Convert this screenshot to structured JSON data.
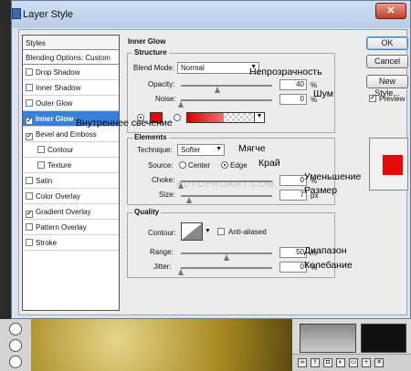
{
  "window": {
    "title": "Layer Style",
    "close": "✕"
  },
  "styles_panel": {
    "header": "Styles",
    "blending": "Blending Options: Custom",
    "items": [
      {
        "label": "Drop Shadow",
        "checked": false
      },
      {
        "label": "Inner Shadow",
        "checked": false
      },
      {
        "label": "Outer Glow",
        "checked": false
      },
      {
        "label": "Inner Glow",
        "checked": true,
        "selected": true
      },
      {
        "label": "Bevel and Emboss",
        "checked": true
      },
      {
        "label": "Contour",
        "checked": false,
        "indent": true
      },
      {
        "label": "Texture",
        "checked": false,
        "indent": true
      },
      {
        "label": "Satin",
        "checked": false
      },
      {
        "label": "Color Overlay",
        "checked": false
      },
      {
        "label": "Gradient Overlay",
        "checked": true
      },
      {
        "label": "Pattern Overlay",
        "checked": false
      },
      {
        "label": "Stroke",
        "checked": false
      }
    ]
  },
  "inner_glow": {
    "title": "Inner Glow",
    "structure": {
      "title": "Structure",
      "blend_mode_label": "Blend Mode:",
      "blend_mode_value": "Normal",
      "opacity_label": "Opacity:",
      "opacity_value": "40",
      "opacity_unit": "%",
      "opacity_fraction": 0.4,
      "noise_label": "Noise:",
      "noise_value": "0",
      "noise_unit": "%",
      "noise_fraction": 0,
      "color": "#e10d0d"
    },
    "elements": {
      "title": "Elements",
      "technique_label": "Technique:",
      "technique_value": "Softer",
      "source_label": "Source:",
      "source_center": "Center",
      "source_edge": "Edge",
      "source_selected": "Edge",
      "choke_label": "Choke:",
      "choke_value": "0",
      "choke_unit": "%",
      "choke_fraction": 0,
      "size_label": "Size:",
      "size_value": "7",
      "size_unit": "px"
    },
    "quality": {
      "title": "Quality",
      "contour_label": "Contour:",
      "anti_aliased_label": "Anti-aliased",
      "anti_aliased": false,
      "range_label": "Range:",
      "range_value": "50",
      "range_unit": "%",
      "range_fraction": 0.5,
      "jitter_label": "Jitter:",
      "jitter_value": "0",
      "jitter_unit": "%",
      "jitter_fraction": 0
    }
  },
  "buttons": {
    "ok": "OK",
    "cancel": "Cancel",
    "new_style": "New Style...",
    "preview_label": "Preview",
    "preview_checked": true,
    "preview_color": "#e50b0b"
  },
  "annotations": {
    "inner_glow": "Внутреннее свечение",
    "opacity": "Непрозрачность",
    "noise": "Шум",
    "technique": "Мягче",
    "edge": "Край",
    "choke": "Уменьшение",
    "size": "Размер",
    "range": "Диапазон",
    "jitter": "Колебание"
  },
  "watermark": "AUTOPROART.COM"
}
